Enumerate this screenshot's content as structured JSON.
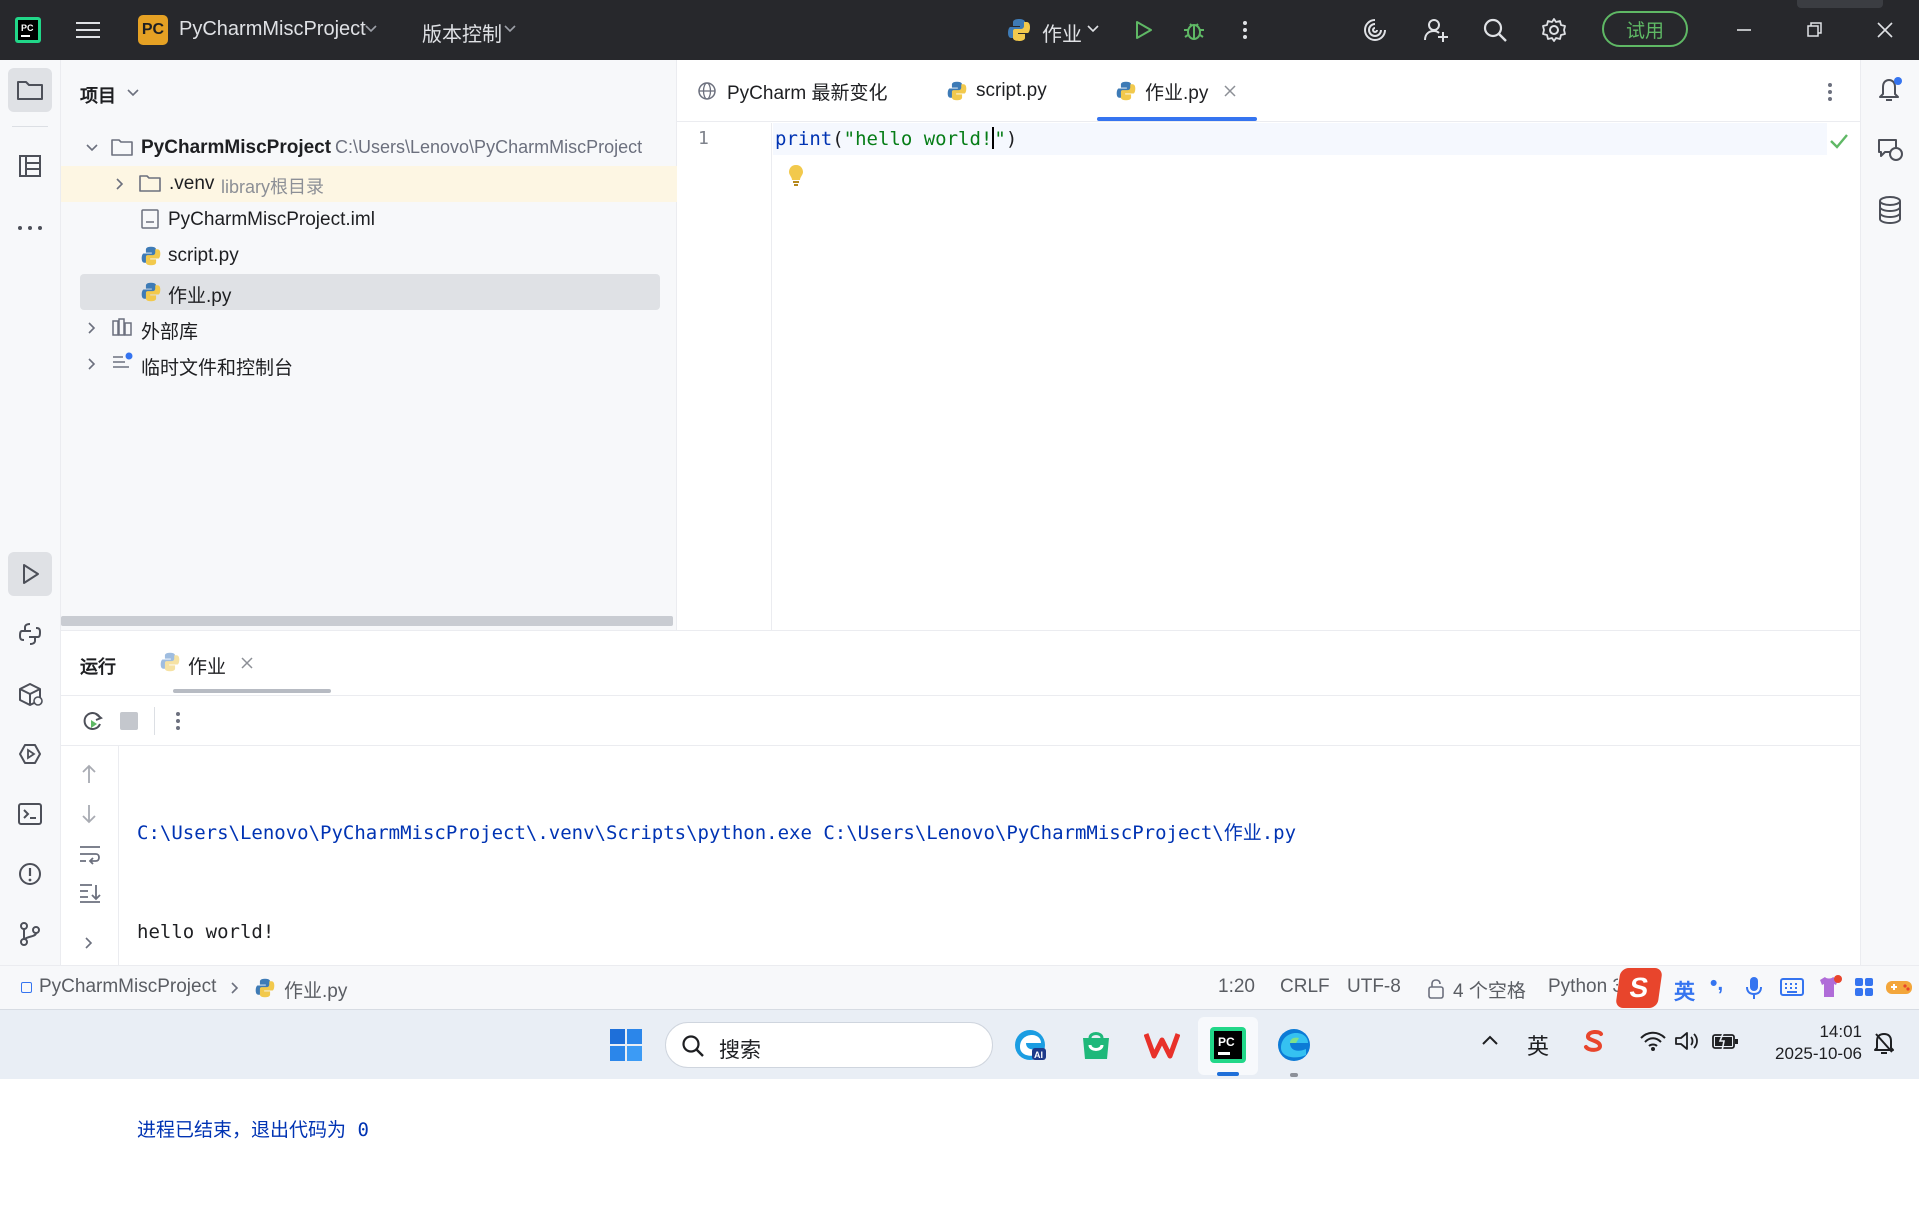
{
  "titlebar": {
    "app_badge": "PC",
    "project_name": "PyCharmMiscProject",
    "vcs_label": "版本控制",
    "run_config": "作业",
    "trial_label": "试用"
  },
  "project_panel": {
    "title": "项目",
    "root_name": "PyCharmMiscProject",
    "root_path": "C:\\Users\\Lenovo\\PyCharmMiscProject",
    "venv_name": ".venv",
    "venv_hint": "library根目录",
    "iml_file": "PyCharmMiscProject.iml",
    "script_file": "script.py",
    "homework_file": "作业.py",
    "external_libs": "外部库",
    "scratches": "临时文件和控制台"
  },
  "editor": {
    "tabs": [
      {
        "label": "PyCharm 最新变化"
      },
      {
        "label": "script.py"
      },
      {
        "label": "作业.py"
      }
    ],
    "line_number": "1",
    "code_fn": "print",
    "code_open": "(",
    "code_string_a": "\"hello world!",
    "code_string_b": "\"",
    "code_close": ")"
  },
  "run_panel": {
    "title": "运行",
    "tab_label": "作业",
    "output": {
      "command": "C:\\Users\\Lenovo\\PyCharmMiscProject\\.venv\\Scripts\\python.exe C:\\Users\\Lenovo\\PyCharmMiscProject\\作业.py",
      "stdout": "hello world!",
      "exit_text": "进程已结束，退出代码为 ",
      "exit_code": "0"
    }
  },
  "statusbar": {
    "breadcrumb_project": "PyCharmMiscProject",
    "breadcrumb_file": "作业.py",
    "caret": "1:20",
    "line_sep": "CRLF",
    "encoding": "UTF-8",
    "indent": "4 个空格",
    "interpreter": "Python 3"
  },
  "ime": {
    "lang": "英",
    "punct": "•,"
  },
  "taskbar": {
    "search_placeholder": "搜索",
    "tray_lang": "英",
    "time": "14:01",
    "date": "2025-10-06"
  },
  "colors": {
    "titlebar_bg": "#27282c",
    "accent_blue": "#3574f0",
    "selection_bg": "#dfe1e5",
    "venv_highlight": "#fdf6e3",
    "run_green": "#5fb865",
    "string_green": "#067d17",
    "console_blue": "#0033b3"
  }
}
